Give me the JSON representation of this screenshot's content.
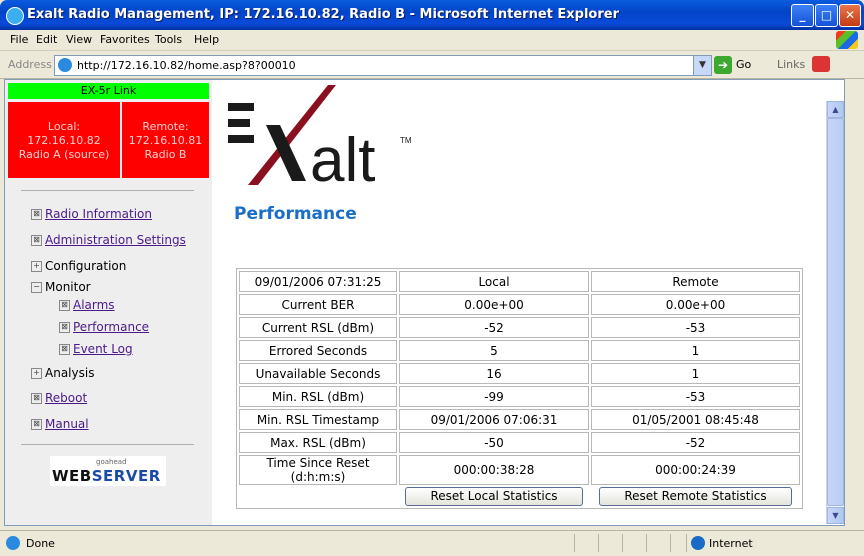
{
  "window": {
    "title": "Exalt Radio Management, IP: 172.16.10.82, Radio B - Microsoft Internet Explorer",
    "minimize": "_",
    "maximize": "□",
    "close": "✕"
  },
  "menu": [
    "File",
    "Edit",
    "View",
    "Favorites",
    "Tools",
    "Help"
  ],
  "address": {
    "label": "Address",
    "url": "http://172.16.10.82/home.asp?8?00010",
    "go_label": "Go",
    "links_label": "Links"
  },
  "link_status": {
    "header": "EX-5r Link",
    "local": {
      "label": "Local:",
      "ip": "172.16.10.82",
      "radio": "Radio A (source)"
    },
    "remote": {
      "label": "Remote:",
      "ip": "172.16.10.81",
      "radio": "Radio B"
    },
    "header_color": "#00ff00",
    "status_color": "#ff0000"
  },
  "nav": {
    "radio_information": "Radio Information",
    "administration_settings": "Administration Settings",
    "configuration": "Configuration",
    "monitor": "Monitor",
    "alarms": "Alarms",
    "performance": "Performance",
    "event_log": "Event Log",
    "analysis": "Analysis",
    "reboot": "Reboot",
    "manual": "Manual"
  },
  "webserver_badge": {
    "small": "goahead",
    "web": "WEB",
    "server": "SERVER"
  },
  "logo": {
    "text": "alt",
    "tm": "TM"
  },
  "page": {
    "title": "Performance"
  },
  "performance_table": {
    "timestamp": "09/01/2006 07:31:25",
    "col_local": "Local",
    "col_remote": "Remote",
    "rows": [
      {
        "label": "Current BER",
        "local": "0.00e+00",
        "remote": "0.00e+00"
      },
      {
        "label": "Current RSL (dBm)",
        "local": "-52",
        "remote": "-53"
      },
      {
        "label": "Errored Seconds",
        "local": "5",
        "remote": "1"
      },
      {
        "label": "Unavailable Seconds",
        "local": "16",
        "remote": "1"
      },
      {
        "label": "Min. RSL (dBm)",
        "local": "-99",
        "remote": "-53"
      },
      {
        "label": "Min. RSL Timestamp",
        "local": "09/01/2006 07:06:31",
        "remote": "01/05/2001 08:45:48"
      },
      {
        "label": "Max. RSL (dBm)",
        "local": "-50",
        "remote": "-52"
      },
      {
        "label": "Time Since Reset (d:h:m:s)",
        "local": "000:00:38:28",
        "remote": "000:00:24:39"
      }
    ],
    "reset_local_label": "Reset Local Statistics",
    "reset_remote_label": "Reset Remote Statistics"
  },
  "statusbar": {
    "text": "Done",
    "zone": "Internet"
  }
}
